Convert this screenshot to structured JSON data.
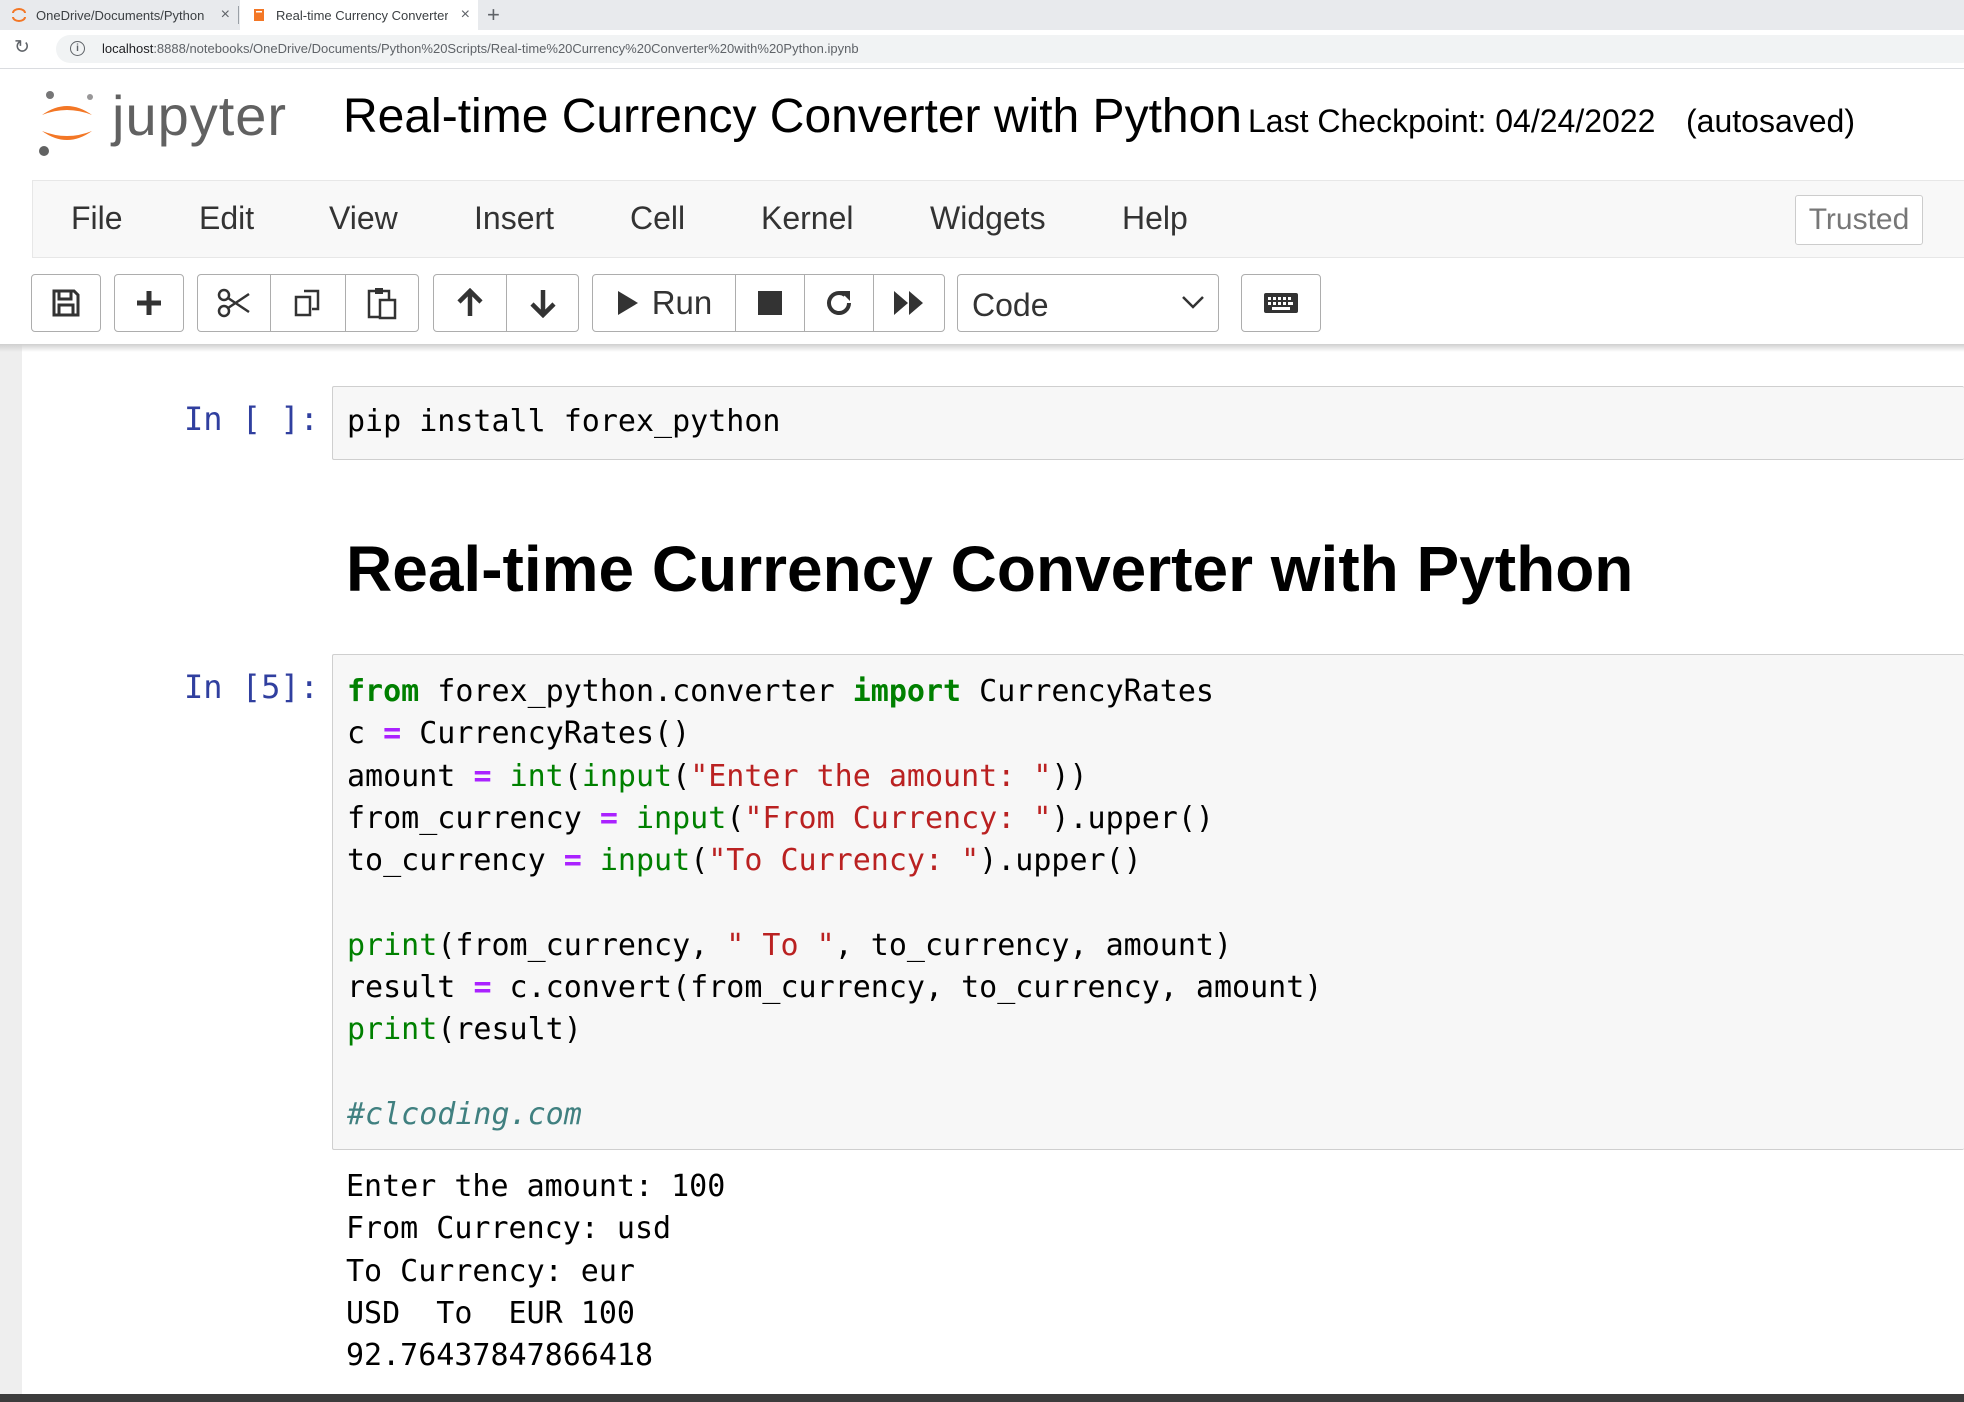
{
  "browser": {
    "tabs": [
      {
        "title": "OneDrive/Documents/Python Scripts/"
      },
      {
        "title": "Real-time Currency Converter with Python"
      }
    ],
    "url_host": "localhost",
    "url_rest": ":8888/notebooks/OneDrive/Documents/Python%20Scripts/Real-time%20Currency%20Converter%20with%20Python.ipynb"
  },
  "header": {
    "logo_text": "jupyter",
    "notebook_title": "Real-time Currency Converter with Python",
    "checkpoint": "Last Checkpoint: 04/24/2022",
    "autosaved": "(autosaved)"
  },
  "menubar": {
    "items": [
      "File",
      "Edit",
      "View",
      "Insert",
      "Cell",
      "Kernel",
      "Widgets",
      "Help"
    ],
    "trusted": "Trusted"
  },
  "toolbar": {
    "run_label": "Run",
    "cell_type": "Code"
  },
  "cells": {
    "cell1": {
      "prompt": "In [ ]:",
      "code": "pip install forex_python"
    },
    "markdown": {
      "heading": "Real-time Currency Converter with Python"
    },
    "cell2": {
      "prompt": "In [5]:",
      "lines": {
        "l1": {
          "kw1": "from",
          "mod": " forex_python.converter ",
          "kw2": "import",
          "name": " CurrencyRates"
        },
        "l2": {
          "a": "c ",
          "op": "=",
          "b": " CurrencyRates()"
        },
        "l3": {
          "a": "amount ",
          "op": "=",
          "sp": " ",
          "f1": "int",
          "p1": "(",
          "f2": "input",
          "p2": "(",
          "s": "\"Enter the amount: \"",
          "p3": "))"
        },
        "l4": {
          "a": "from_currency ",
          "op": "=",
          "sp": " ",
          "f": "input",
          "p1": "(",
          "s": "\"From Currency: \"",
          "p2": ").upper()"
        },
        "l5": {
          "a": "to_currency ",
          "op": "=",
          "sp": " ",
          "f": "input",
          "p1": "(",
          "s": "\"To Currency: \"",
          "p2": ").upper()"
        },
        "l6": {
          "f": "print",
          "a": "(from_currency, ",
          "s": "\" To \"",
          "b": ", to_currency, amount)"
        },
        "l7": {
          "a": "result ",
          "op": "=",
          "b": " c.convert(from_currency, to_currency, amount)"
        },
        "l8": {
          "f": "print",
          "a": "(result)"
        },
        "l9": {
          "cm": "#clcoding.com"
        }
      },
      "output": "Enter the amount: 100\nFrom Currency: usd\nTo Currency: eur\nUSD  To  EUR 100\n92.76437847866418"
    }
  },
  "colors": {
    "prompt": "#303f9f",
    "keyword": "#008000",
    "operator": "#aa22ff",
    "string": "#ba2121",
    "comment": "#408080",
    "logo_orange": "#f37726"
  }
}
